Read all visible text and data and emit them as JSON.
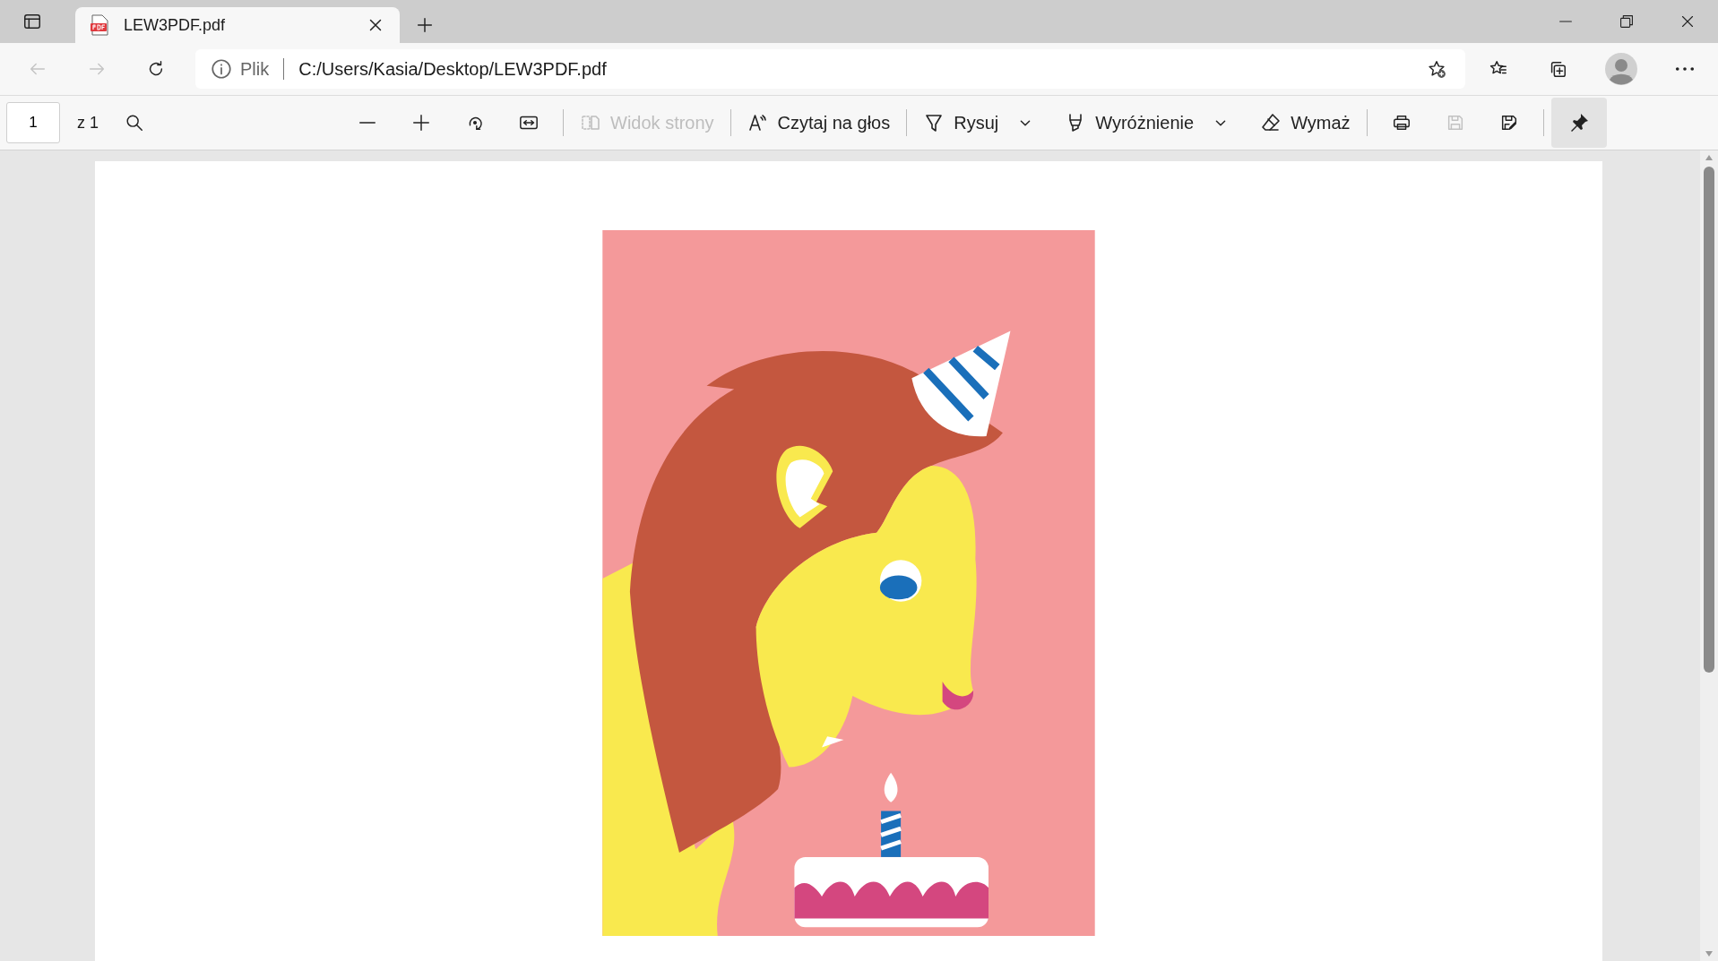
{
  "tab": {
    "title": "LEW3PDF.pdf",
    "selected": true
  },
  "nav": {
    "back_disabled": true,
    "forward_disabled": true
  },
  "address_bar": {
    "scheme_label": "Plik",
    "url": "C:/Users/Kasia/Desktop/LEW3PDF.pdf"
  },
  "pdf_toolbar": {
    "page_number": "1",
    "page_count": "z 1",
    "tools": [
      {
        "kind": "icon",
        "disabled": false
      },
      {
        "kind": "icon",
        "disabled": false
      },
      {
        "kind": "icon",
        "disabled": false
      },
      {
        "kind": "icon",
        "disabled": false
      },
      {
        "kind": "separator"
      },
      {
        "kind": "text",
        "label": "Widok strony",
        "disabled": true
      },
      {
        "kind": "separator"
      },
      {
        "kind": "text",
        "label": "Czytaj na głos",
        "disabled": false
      },
      {
        "kind": "separator"
      },
      {
        "kind": "dropdown",
        "label": "Rysuj",
        "disabled": false
      },
      {
        "kind": "dropdown",
        "label": "Wyróżnienie",
        "disabled": false
      },
      {
        "kind": "text",
        "label": "Wymaż",
        "disabled": false
      },
      {
        "kind": "separator"
      },
      {
        "kind": "icon",
        "disabled": false
      },
      {
        "kind": "icon",
        "disabled": true
      },
      {
        "kind": "icon",
        "disabled": false
      },
      {
        "kind": "separator"
      }
    ],
    "pin": {
      "selected": true
    }
  }
}
